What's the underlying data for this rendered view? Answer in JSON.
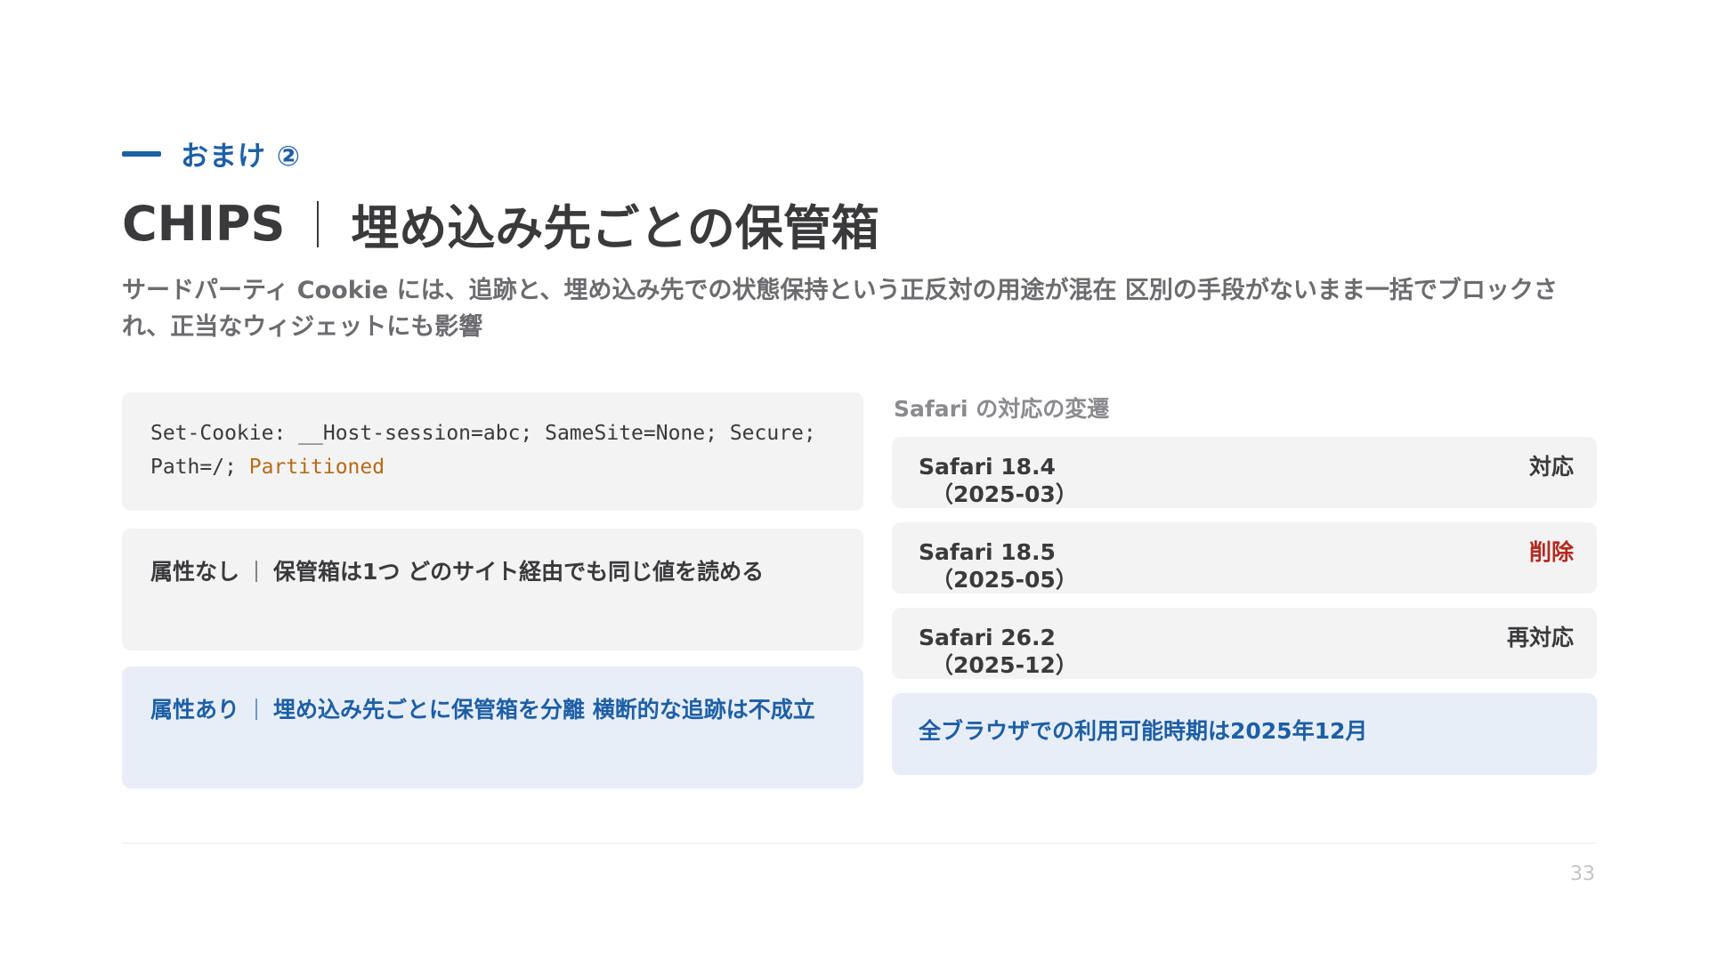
{
  "kicker": "おまけ ②",
  "title": {
    "main": "CHIPS",
    "sub": "埋め込み先ごとの保管箱"
  },
  "lead": "サードパーティ Cookie には、追跡と、埋め込み先での状態保持という正反対の用途が混在 区別の手段がないまま一括でブロックされ、正当なウィジェットにも影響",
  "code": {
    "line1": "Set-Cookie: __Host-session=abc; SameSite=None; Secure;",
    "line2_prefix": "Path=/; ",
    "line2_accent": "Partitioned"
  },
  "attributes": {
    "none": {
      "label": "属性なし",
      "text": "保管箱は1つ どのサイト経由でも同じ値を読める"
    },
    "yes": {
      "label": "属性あり",
      "text": "埋め込み先ごとに保管箱を分離 横断的な追跡は不成立"
    }
  },
  "safari": {
    "heading": "Safari の対応の変遷",
    "rows": [
      {
        "version": "Safari 18.4",
        "date": "（2025-03）",
        "status": "対応"
      },
      {
        "version": "Safari 18.5",
        "date": "（2025-05）",
        "status": "削除"
      },
      {
        "version": "Safari 26.2",
        "date": "（2025-12）",
        "status": "再対応"
      }
    ],
    "summary": "全ブラウザでの利用可能時期は2025年12月"
  },
  "colors": {
    "accent": "#1d5fa6",
    "code_accent": "#b76a16",
    "removed": "#b52a1f"
  },
  "page_number": "33"
}
